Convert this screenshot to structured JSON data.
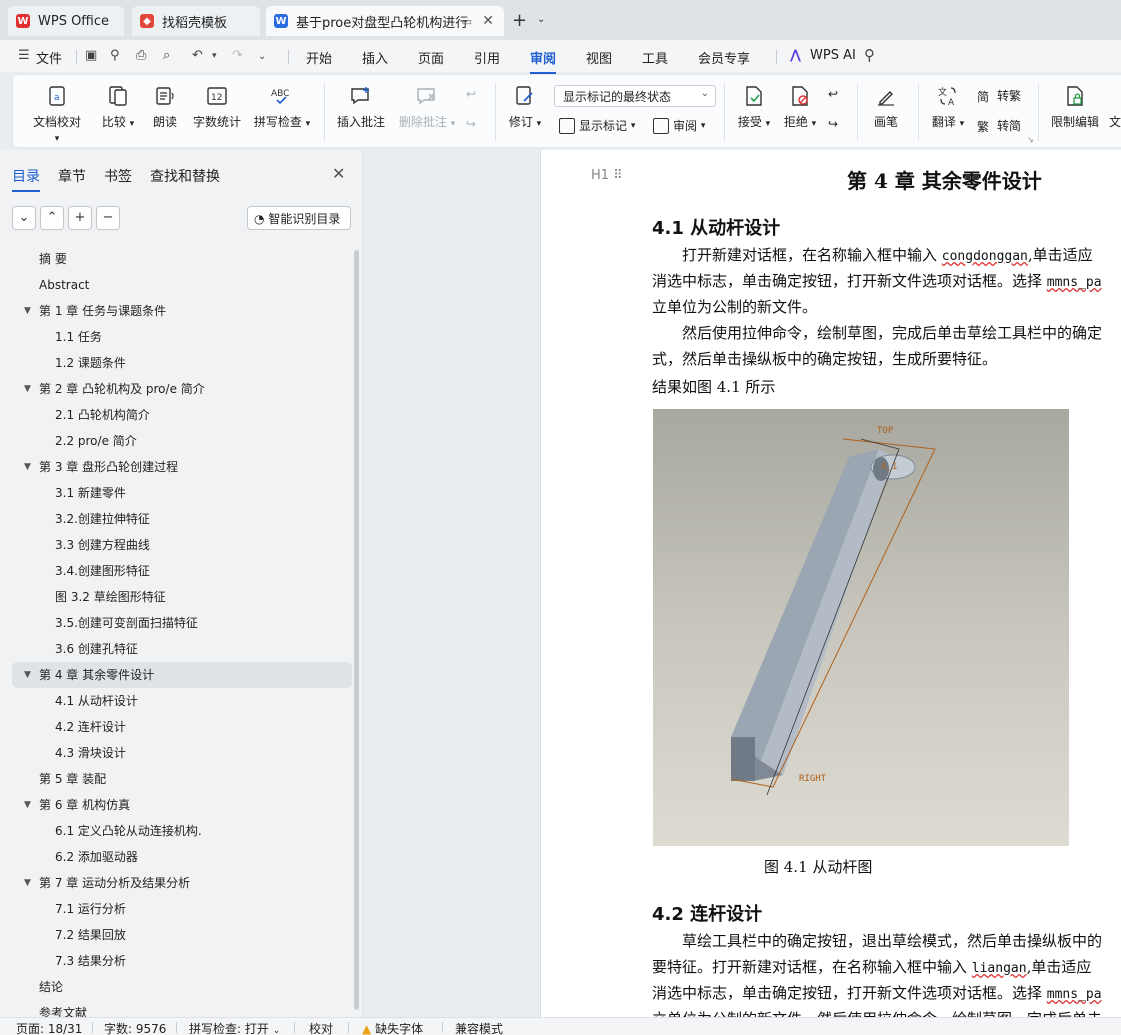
{
  "tabs": [
    {
      "label": "WPS Office",
      "icon": "wps-logo-icon"
    },
    {
      "label": "找稻壳模板",
      "icon": "docer-icon"
    },
    {
      "label": "基于proe对盘型凸轮机构进行",
      "icon": "word-doc-icon"
    }
  ],
  "menu": {
    "file": "文件",
    "items": [
      "开始",
      "插入",
      "页面",
      "引用",
      "审阅",
      "视图",
      "工具",
      "会员专享"
    ],
    "active": "审阅",
    "wps_ai": "WPS AI"
  },
  "ribbon": {
    "doc_check": "文档校对",
    "compare": "比较",
    "read_aloud": "朗读",
    "word_count": "字数统计",
    "spell_check": "拼写检查",
    "insert_comment": "插入批注",
    "delete_comment": "删除批注",
    "track_changes": "修订",
    "markup_state": "显示标记的最终状态",
    "show_markup": "显示标记",
    "review": "审阅",
    "accept": "接受",
    "reject": "拒绝",
    "pen": "画笔",
    "translate": "翻译",
    "to_traditional": "转繁",
    "to_simplified": "转简",
    "restrict_edit": "限制编辑",
    "doc_more": "文"
  },
  "nav": {
    "tabs": [
      "目录",
      "章节",
      "书签",
      "查找和替换"
    ],
    "active_tab": "目录",
    "smart_toc": "智能识别目录",
    "items": [
      {
        "text": "摘 要",
        "level": 1,
        "arrow": false
      },
      {
        "text": "Abstract",
        "level": 1,
        "arrow": false
      },
      {
        "text": "第 1 章   任务与课题条件",
        "level": 1,
        "arrow": true
      },
      {
        "text": "1.1  任务",
        "level": 2,
        "arrow": false
      },
      {
        "text": "1.2  课题条件",
        "level": 2,
        "arrow": false
      },
      {
        "text": "第 2 章  凸轮机构及 pro/e 简介",
        "level": 1,
        "arrow": true
      },
      {
        "text": "2.1  凸轮机构简介",
        "level": 2,
        "arrow": false
      },
      {
        "text": "2.2 pro/e 简介",
        "level": 2,
        "arrow": false
      },
      {
        "text": "第 3 章  盘形凸轮创建过程",
        "level": 1,
        "arrow": true
      },
      {
        "text": "3.1  新建零件",
        "level": 2,
        "arrow": false
      },
      {
        "text": "3.2.创建拉伸特征",
        "level": 2,
        "arrow": false
      },
      {
        "text": "3.3  创建方程曲线",
        "level": 2,
        "arrow": false
      },
      {
        "text": "3.4.创建图形特征",
        "level": 2,
        "arrow": false
      },
      {
        "text": "图 3.2  草绘图形特征",
        "level": 2,
        "arrow": false
      },
      {
        "text": "3.5.创建可变剖面扫描特征",
        "level": 2,
        "arrow": false
      },
      {
        "text": "3.6 创建孔特征",
        "level": 2,
        "arrow": false
      },
      {
        "text": "第 4 章    其余零件设计",
        "level": 1,
        "arrow": true,
        "selected": true
      },
      {
        "text": "4.1 从动杆设计",
        "level": 2,
        "arrow": false
      },
      {
        "text": "4.2 连杆设计",
        "level": 2,
        "arrow": false
      },
      {
        "text": "4.3 滑块设计",
        "level": 2,
        "arrow": false
      },
      {
        "text": "第 5 章  装配",
        "level": 1,
        "arrow": false
      },
      {
        "text": "第 6 章  机构仿真",
        "level": 1,
        "arrow": true
      },
      {
        "text": "6.1  定义凸轮从动连接机构.",
        "level": 2,
        "arrow": false
      },
      {
        "text": "6.2  添加驱动器",
        "level": 2,
        "arrow": false
      },
      {
        "text": "第 7 章    运动分析及结果分析",
        "level": 1,
        "arrow": true
      },
      {
        "text": "7.1  运行分析",
        "level": 2,
        "arrow": false
      },
      {
        "text": "7.2    结果回放",
        "level": 2,
        "arrow": false
      },
      {
        "text": "7.3    结果分析",
        "level": 2,
        "arrow": false
      },
      {
        "text": "结论",
        "level": 1,
        "arrow": false
      },
      {
        "text": "参考文献",
        "level": 1,
        "arrow": false
      }
    ]
  },
  "doc": {
    "heading_marker": "H1",
    "chapter_title": "第 4 章   其余零件设计",
    "sec1_title": "4.1 从动杆设计",
    "p1_l1a": "打开新建对话框，在名称输入框中输入 ",
    "p1_l1_code": "congdonggan",
    "p1_l1b": ",单击适应",
    "p1_l2a": "消选中标志，单击确定按钮，打开新文件选项对话框。选择 ",
    "p1_l2_code": "mmns_pa",
    "p1_l3": "立单位为公制的新文件。",
    "p2_l1": "然后使用拉伸命令，绘制草图，完成后单击草绘工具栏中的确定",
    "p2_l2": "式，然后单击操纵板中的确定按钮，生成所要特征。",
    "p3": "结果如图 4.1 所示",
    "fig_label_top": "TOP",
    "fig_label_a": "A_1",
    "fig_label_right": "RIGHT",
    "fig_caption": "图 4.1  从动杆图",
    "sec2_title": "4.2 连杆设计",
    "p4_l1": "草绘工具栏中的确定按钮，退出草绘模式，然后单击操纵板中的",
    "p4_l2a": "要特征。打开新建对话框，在名称输入框中输入 ",
    "p4_l2_code": "liangan",
    "p4_l2b": ",单击适应",
    "p4_l3a": "消选中标志，单击确定按钮，打开新文件选项对话框。选择 ",
    "p4_l3_code": "mmns_pa",
    "p4_l4": "立单位为公制的新文件，然后使用拉伸命令，绘制草图，完成后单击"
  },
  "status": {
    "page": "页面: 18/31",
    "words": "字数: 9576",
    "spell": "拼写检查: 打开",
    "proof": "校对",
    "missing_font": "缺失字体",
    "compat": "兼容模式"
  },
  "colors": {
    "accent": "#1f5fd1",
    "warning": "#e8a317"
  }
}
